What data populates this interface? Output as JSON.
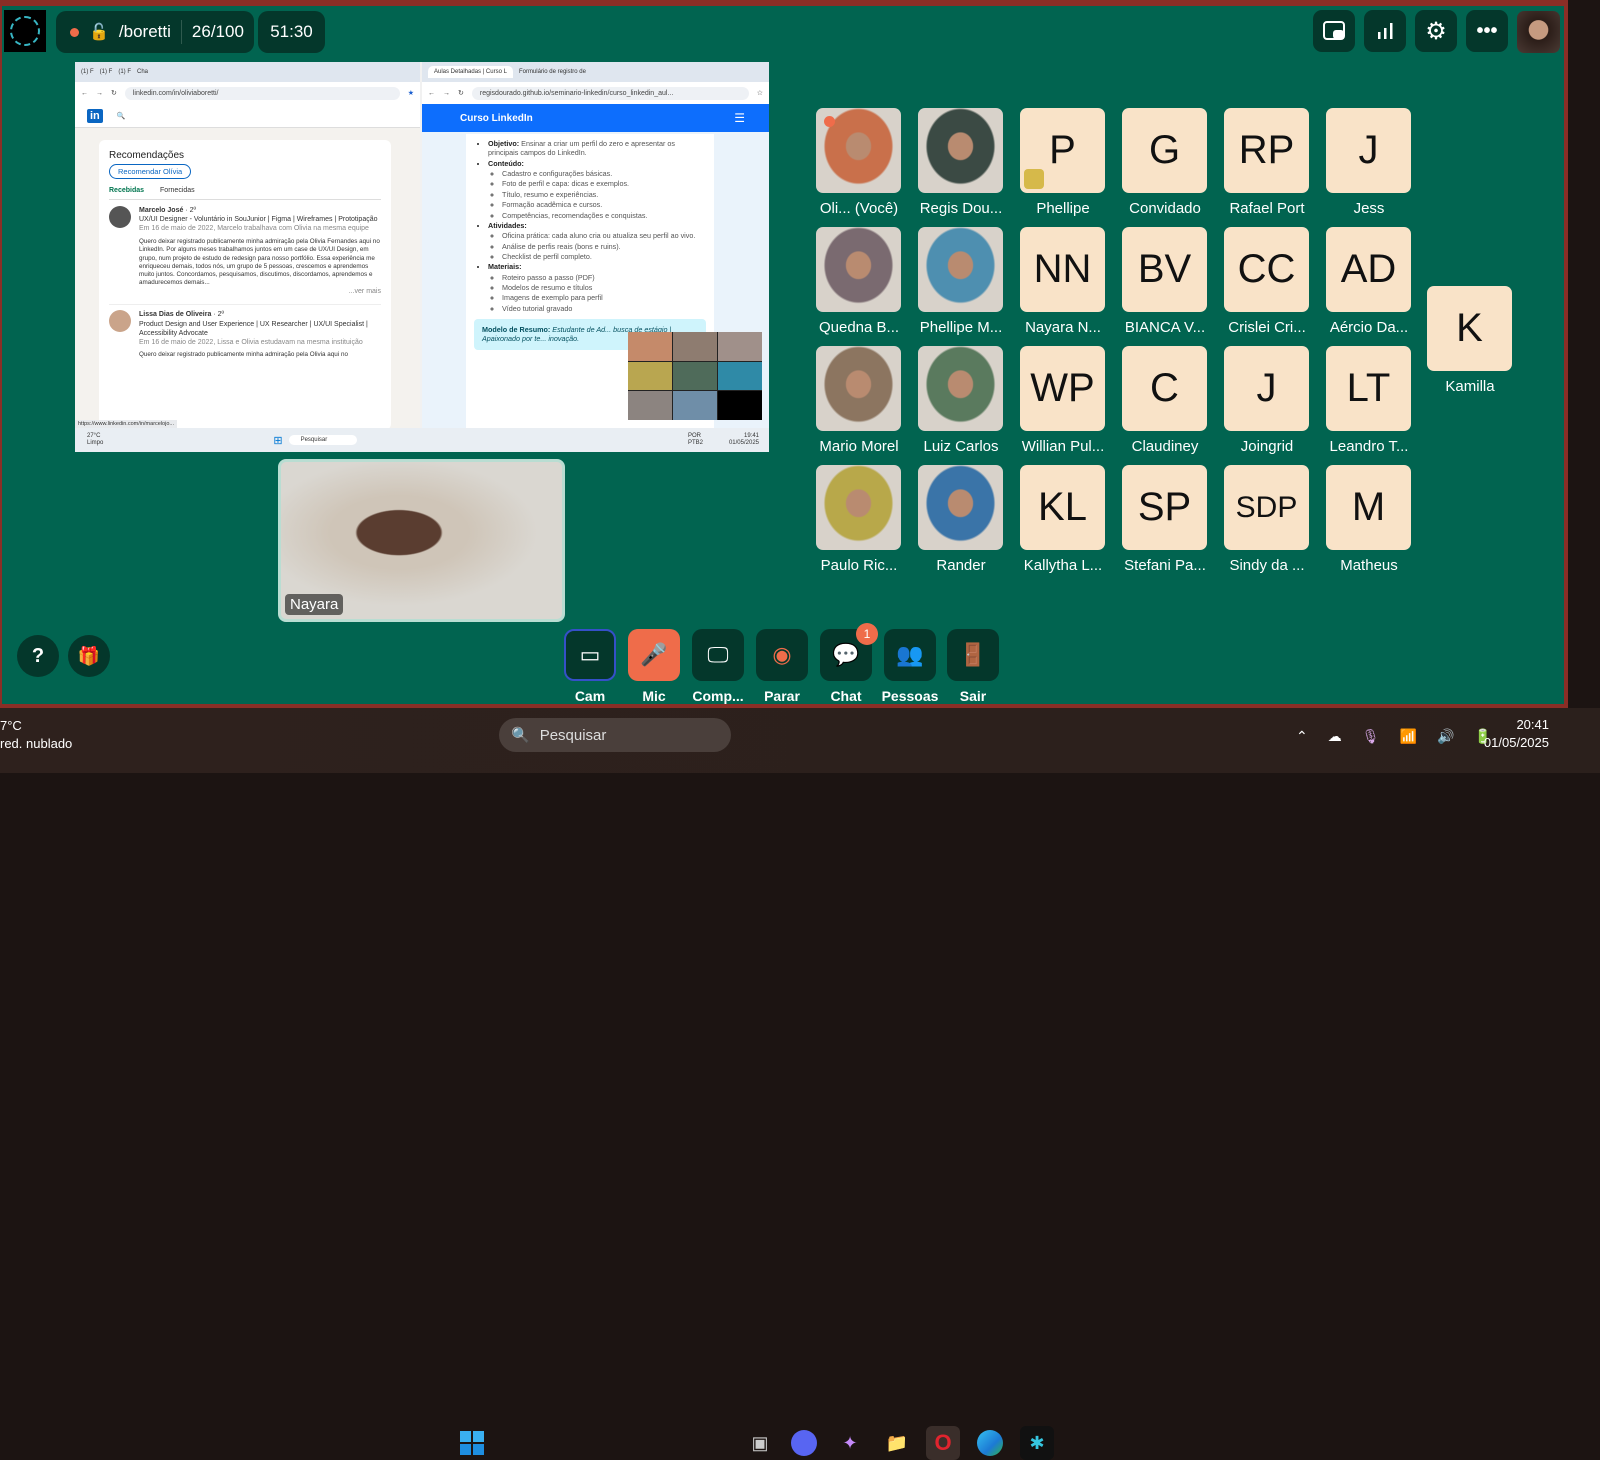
{
  "topbar": {
    "room": "/boretti",
    "count": "26/100",
    "timer": "51:30"
  },
  "left_browser": {
    "tabs": [
      "(1) F",
      "(1) F",
      "(1) F",
      "Cha"
    ],
    "url": "linkedin.com/in/oliviaboretti/",
    "section_title": "Recomendações",
    "recommend_button": "Recomendar Olívia",
    "tab_received": "Recebidas",
    "tab_given": "Fornecidas",
    "recs": [
      {
        "name": "Marcelo José",
        "degree": "· 2º",
        "headline": "UX/UI Designer - Voluntário in SouJunior | Figma | Wireframes | Prototipação",
        "meta": "Em 16 de maio de 2022, Marcelo trabalhava com Olivia na mesma equipe",
        "text": "Quero deixar registrado publicamente minha admiração pela Olivia Fernandes aqui no LinkedIn. Por alguns meses trabalhamos juntos em um case de UX/UI Design, em grupo, num projeto de estudo de redesign para nosso portfólio. Essa experiência me enriqueceu demais, todos nós, um grupo de 5 pessoas, crescemos e aprendemos muito juntos. Concordamos, pesquisamos, discutimos, discordamos, aprendemos e amadurecemos demais...",
        "more": "...ver mais"
      },
      {
        "name": "Lissa Dias de Oliveira",
        "degree": "· 2º",
        "headline": "Product Design and User Experience | UX Researcher | UX/UI Specialist | Accessibility Advocate",
        "meta": "Em 16 de maio de 2022, Lissa e Olivia estudavam na mesma instituição",
        "text": "Quero deixar registrado publicamente minha admiração pela Olivia aqui no"
      }
    ],
    "status_url": "https://www.linkedin.com/in/marcelojo..."
  },
  "right_browser": {
    "tabs": [
      "Aulas Detalhadas | Curso L",
      "Formulário de registro de"
    ],
    "url": "regisdourado.github.io/seminario-linkedin/curso_linkedin_aul...",
    "brand": "Curso LinkedIn",
    "sections": [
      {
        "label": "Objetivo:",
        "text": "Ensinar a criar um perfil do zero e apresentar os principais campos do LinkedIn.",
        "items": []
      },
      {
        "label": "Conteúdo:",
        "text": "",
        "items": [
          "Cadastro e configurações básicas.",
          "Foto de perfil e capa: dicas e exemplos.",
          "Título, resumo e experiências.",
          "Formação acadêmica e cursos.",
          "Competências, recomendações e conquistas."
        ]
      },
      {
        "label": "Atividades:",
        "text": "",
        "items": [
          "Oficina prática: cada aluno cria ou atualiza seu perfil ao vivo.",
          "Análise de perfis reais (bons e ruins).",
          "Checklist de perfil completo."
        ]
      },
      {
        "label": "Materiais:",
        "text": "",
        "items": [
          "Roteiro passo a passo (PDF)",
          "Modelos de resumo e títulos",
          "Imagens de exemplo para perfil",
          "Vídeo tutorial gravado"
        ]
      }
    ],
    "callout_label": "Modelo de Resumo:",
    "callout_text": "Estudante de Ad... busca de estágio | Apaixonado por te... inovação."
  },
  "inner_taskbar": {
    "temp": "27°C",
    "weather": "Limpo",
    "search": "Pesquisar",
    "lang": "POR",
    "kb": "PTB2",
    "time": "19:41",
    "date": "01/05/2025"
  },
  "presenter": {
    "name": "Nayara"
  },
  "participants": [
    {
      "name": "Oli...  (Você)",
      "initials": "",
      "photo": true,
      "color": "#c9704b"
    },
    {
      "name": "Regis Dou...",
      "initials": "",
      "photo": true,
      "color": "#3b4a44"
    },
    {
      "name": "Phellipe",
      "initials": "P",
      "photo": false
    },
    {
      "name": "Convidado",
      "initials": "G",
      "photo": false
    },
    {
      "name": "Rafael Port",
      "initials": "RP",
      "photo": false
    },
    {
      "name": "Jess",
      "initials": "J",
      "photo": false
    },
    {
      "name": "Quedna B...",
      "initials": "",
      "photo": true,
      "color": "#7a6a70"
    },
    {
      "name": "Phellipe M...",
      "initials": "",
      "photo": true,
      "color": "#4e8fb0"
    },
    {
      "name": "Nayara N...",
      "initials": "NN",
      "photo": false
    },
    {
      "name": "BIANCA V...",
      "initials": "BV",
      "photo": false
    },
    {
      "name": "Crislei Cri...",
      "initials": "CC",
      "photo": false
    },
    {
      "name": "Aércio Da...",
      "initials": "AD",
      "photo": false
    },
    {
      "name": "Mario Morel",
      "initials": "",
      "photo": true,
      "color": "#8c7560"
    },
    {
      "name": "Luiz Carlos",
      "initials": "",
      "photo": true,
      "color": "#5a7a5e"
    },
    {
      "name": "Willian Pul...",
      "initials": "WP",
      "photo": false
    },
    {
      "name": "Claudiney",
      "initials": "C",
      "photo": false
    },
    {
      "name": "Joingrid",
      "initials": "J",
      "photo": false
    },
    {
      "name": "Leandro T...",
      "initials": "LT",
      "photo": false
    },
    {
      "name": "Paulo Ric...",
      "initials": "",
      "photo": true,
      "color": "#b8a84a"
    },
    {
      "name": "Rander",
      "initials": "",
      "photo": true,
      "color": "#3a74a8"
    },
    {
      "name": "Kallytha L...",
      "initials": "KL",
      "photo": false
    },
    {
      "name": "Stefani Pa...",
      "initials": "SP",
      "photo": false
    },
    {
      "name": "Sindy da ...",
      "initials": "SDP",
      "photo": false
    },
    {
      "name": "Matheus",
      "initials": "M",
      "photo": false
    },
    {
      "name": "Kamilla",
      "initials": "K",
      "photo": false
    }
  ],
  "controls": [
    {
      "label": "Cam",
      "icon": "camera-icon"
    },
    {
      "label": "Mic",
      "icon": "mic-off-icon"
    },
    {
      "label": "Comp...",
      "icon": "screen-share-icon"
    },
    {
      "label": "Parar",
      "icon": "record-stop-icon"
    },
    {
      "label": "Chat",
      "icon": "chat-icon",
      "badge": "1"
    },
    {
      "label": "Pessoas",
      "icon": "people-icon"
    },
    {
      "label": "Sair",
      "icon": "leave-icon"
    }
  ],
  "help": "?",
  "taskbar": {
    "temp": "7°C",
    "weather": "red. nublado",
    "search": "Pesquisar",
    "time": "20:41",
    "date": "01/05/2025"
  },
  "colors": {
    "stage": "#016450",
    "dark": "#04372b",
    "accent": "#ef6c4a",
    "tile": "#f9e3c8"
  }
}
